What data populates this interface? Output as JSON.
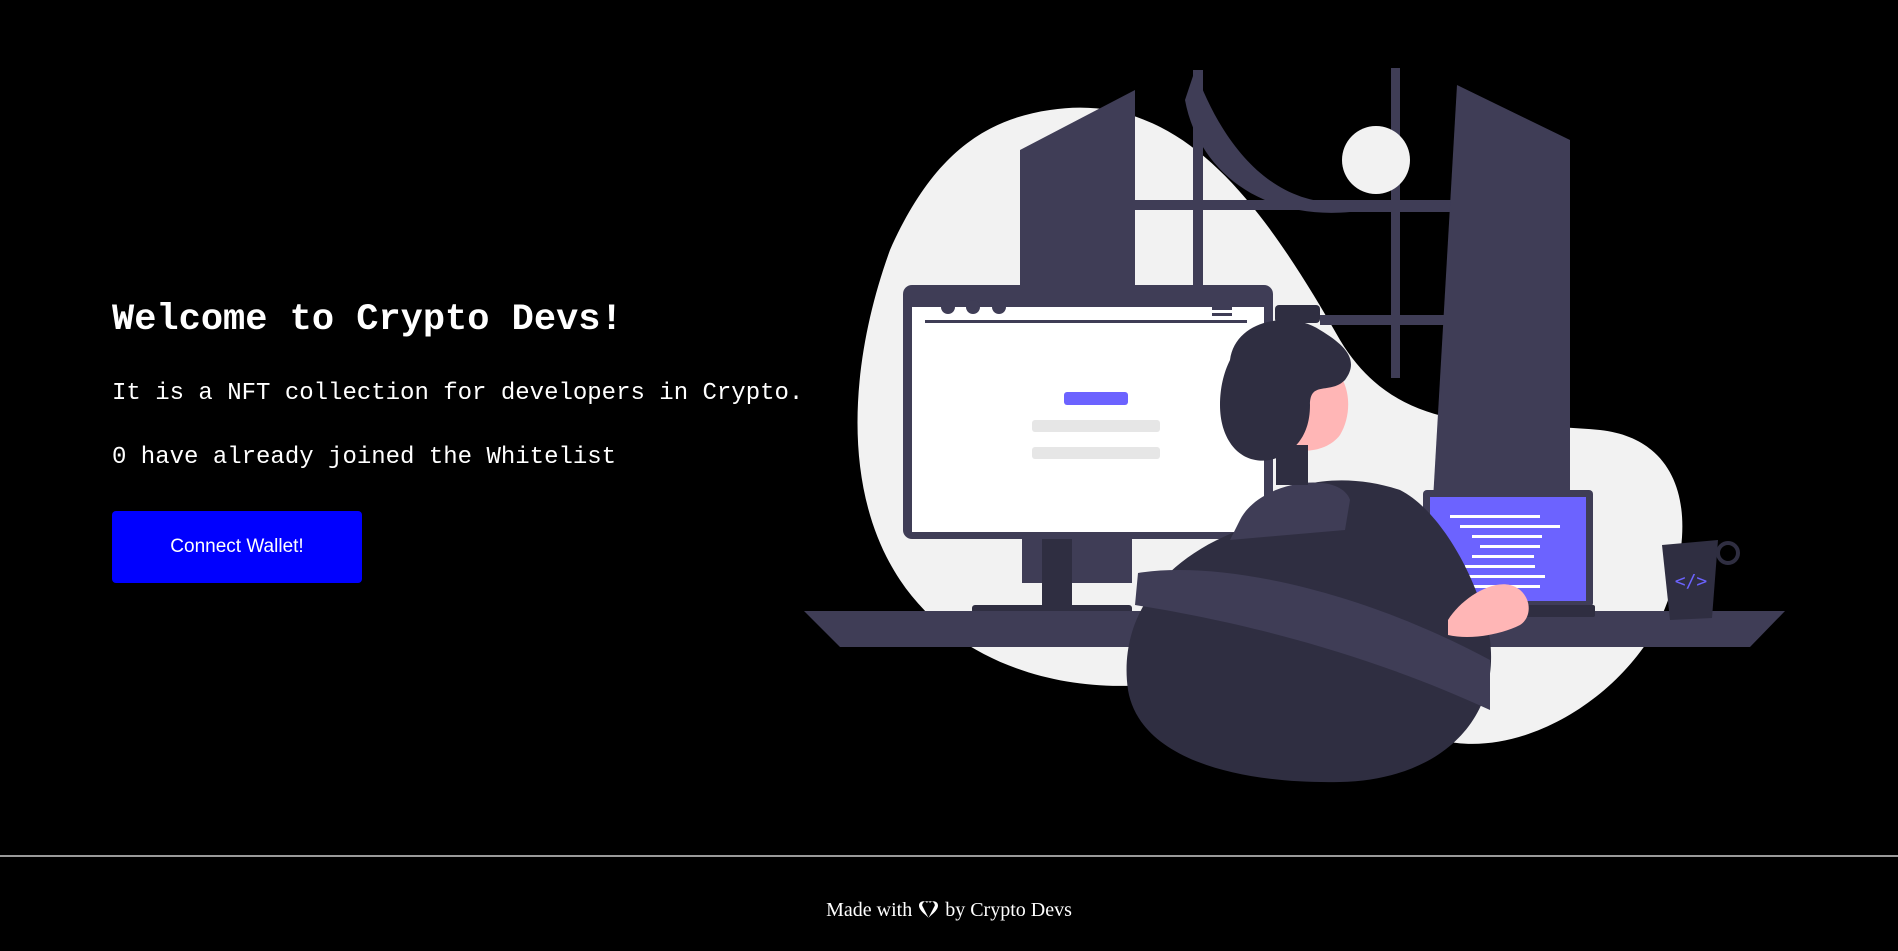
{
  "hero": {
    "title": "Welcome to Crypto Devs!",
    "description": "It is a NFT collection for developers in Crypto.",
    "whitelist_status": "0 have already joined the Whitelist",
    "connect_button_label": "Connect Wallet!"
  },
  "footer": {
    "prefix": "Made with",
    "suffix": "by Crypto Devs",
    "icon": "heart-icon"
  },
  "colors": {
    "background": "#000000",
    "button": "#0000ff",
    "text": "#ffffff",
    "illustration_dark": "#3f3d56",
    "illustration_accent": "#6c63ff",
    "illustration_light": "#f2f2f2",
    "skin": "#ffb6b6"
  },
  "illustration": {
    "laptop_code_icon": "</>"
  }
}
